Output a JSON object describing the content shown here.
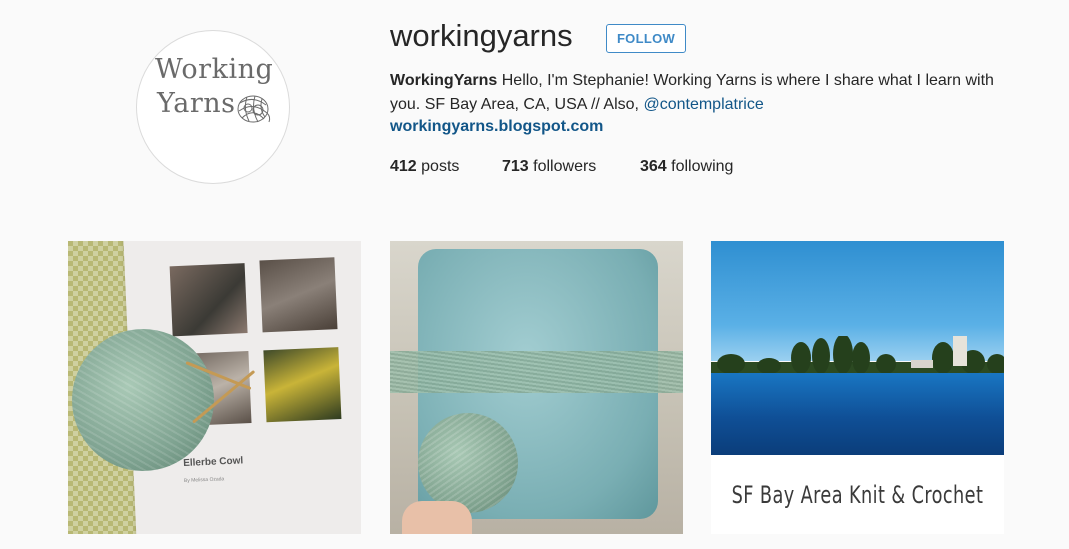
{
  "profile": {
    "avatar": {
      "line1": "Working",
      "line2": "Yarns"
    },
    "username": "workingyarns",
    "follow_label": "FOLLOW",
    "full_name": "WorkingYarns",
    "bio_text": "Hello, I'm Stephanie! Working Yarns is where I share what I learn with you. SF Bay Area, CA, USA // Also, ",
    "bio_mention": "@contemplatrice",
    "website": "workingyarns.blogspot.com"
  },
  "stats": {
    "posts": {
      "count": "412",
      "label": "posts"
    },
    "followers": {
      "count": "713",
      "label": "followers"
    },
    "following": {
      "count": "364",
      "label": "following"
    }
  },
  "posts": [
    {
      "pattern_title": "Ellerbe Cowl",
      "pattern_sub": "By Melissa Ozada"
    },
    {},
    {
      "caption": "SF Bay Area Knit & Crochet"
    }
  ],
  "colors": {
    "link": "#125688",
    "follow_accent": "#3f8ac7",
    "background": "#fafafa"
  }
}
